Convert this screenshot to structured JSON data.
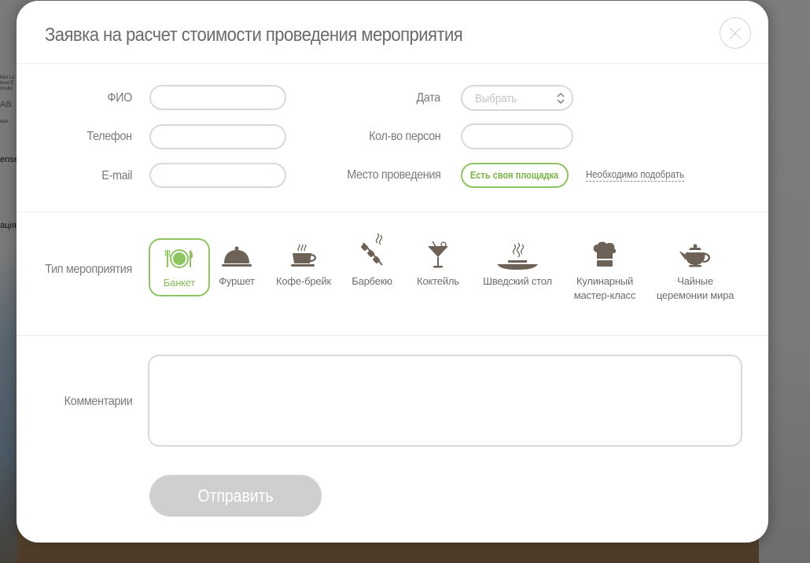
{
  "background": {
    "fragments": [
      "hen La",
      "lture E",
      "ricultu",
      "АВ",
      "еро",
      "ense",
      "ація"
    ]
  },
  "modal": {
    "title": "Заявка на расчет стоимости проведения мероприятия",
    "close_icon": "close-icon"
  },
  "form": {
    "fio_label": "ФИО",
    "phone_label": "Телефон",
    "email_label": "E-mail",
    "date_label": "Дата",
    "date_placeholder": "Выбрать",
    "persons_label": "Кол-во персон",
    "venue_label": "Место проведения",
    "venue_own": "Есть своя площадка",
    "venue_need": "Необходимо подобрать",
    "event_type_label": "Тип мероприятия",
    "comment_label": "Комментарии",
    "submit_label": "Отправить"
  },
  "event_types": [
    {
      "label": "Банкет",
      "icon": "banquet-plate-icon",
      "selected": true
    },
    {
      "label": "Фуршет",
      "icon": "cloche-icon",
      "selected": false
    },
    {
      "label": "Кофе-брейк",
      "icon": "coffee-cup-icon",
      "selected": false
    },
    {
      "label": "Барбекю",
      "icon": "skewer-icon",
      "selected": false
    },
    {
      "label": "Коктейль",
      "icon": "cocktail-glass-icon",
      "selected": false
    },
    {
      "label": "Шведский стол",
      "icon": "hot-dish-icon",
      "selected": false
    },
    {
      "label": "Кулинарный\nмастер-класс",
      "icon": "chef-hat-icon",
      "selected": false
    },
    {
      "label": "Чайные\nцеремонии мира",
      "icon": "teapot-icon",
      "selected": false
    }
  ],
  "colors": {
    "accent_green": "#8dc55e",
    "icon_brown": "#6e6156",
    "submit_disabled": "#cfcfcf"
  }
}
